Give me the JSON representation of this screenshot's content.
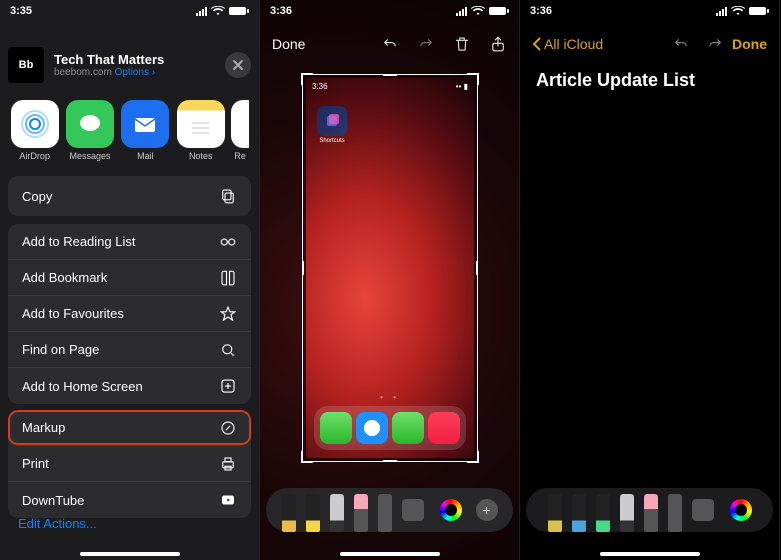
{
  "screen1": {
    "status_time": "3:35",
    "header": {
      "icon_label": "Bb",
      "title": "Tech That Matters",
      "subtitle_site": "beebom.com",
      "options": "Options ›"
    },
    "apps": [
      {
        "name": "AirDrop"
      },
      {
        "name": "Messages"
      },
      {
        "name": "Mail"
      },
      {
        "name": "Notes"
      },
      {
        "name": "Re"
      }
    ],
    "copy": "Copy",
    "actions1": [
      {
        "label": "Add to Reading List",
        "icon": "glasses-icon"
      },
      {
        "label": "Add Bookmark",
        "icon": "book-icon"
      },
      {
        "label": "Add to Favourites",
        "icon": "star-icon"
      },
      {
        "label": "Find on Page",
        "icon": "search-icon"
      },
      {
        "label": "Add to Home Screen",
        "icon": "plus-square-icon"
      }
    ],
    "actions2": [
      {
        "label": "Markup",
        "icon": "markup-icon",
        "highlight": true
      },
      {
        "label": "Print",
        "icon": "print-icon"
      },
      {
        "label": "DownTube",
        "icon": "downtube-icon"
      }
    ],
    "edit_actions": "Edit Actions..."
  },
  "screen2": {
    "status_time": "3:36",
    "done": "Done",
    "inner_time": "3:36",
    "shortcuts_label": "Shortcuts",
    "plus": "+"
  },
  "screen3": {
    "status_time": "3:36",
    "back": "All iCloud",
    "done": "Done",
    "title": "Article Update List"
  }
}
